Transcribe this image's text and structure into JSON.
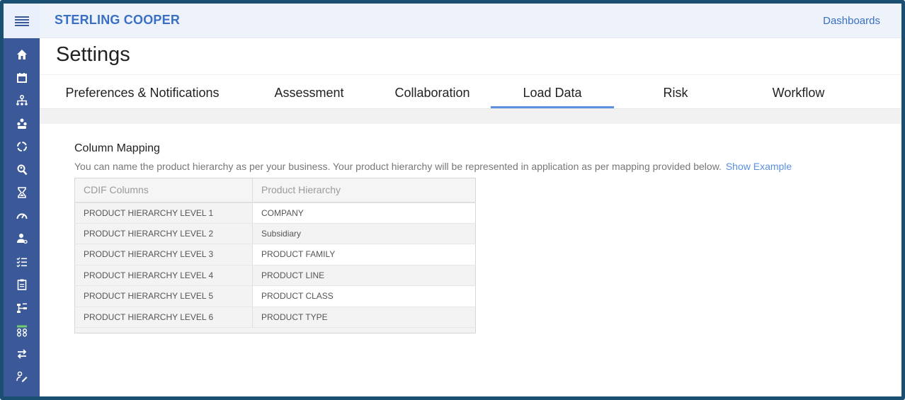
{
  "header": {
    "brand": "STERLING COOPER",
    "dashboards_link": "Dashboards"
  },
  "sidebar": {
    "icons": [
      "home-icon",
      "calendar-icon",
      "org-chart-icon",
      "people-group-icon",
      "cycle-icon",
      "search-person-icon",
      "hourglass-icon",
      "gauge-icon",
      "user-settings-icon",
      "checklist-icon",
      "clipboard-icon",
      "hierarchy-icon",
      "network-icon",
      "swap-icon",
      "user-edit-icon"
    ]
  },
  "page": {
    "title": "Settings"
  },
  "tabs": [
    {
      "label": "Preferences & Notifications"
    },
    {
      "label": "Assessment"
    },
    {
      "label": "Collaboration"
    },
    {
      "label": "Load Data"
    },
    {
      "label": "Risk"
    },
    {
      "label": "Workflow"
    }
  ],
  "active_tab": "Load Data",
  "column_mapping": {
    "title": "Column Mapping",
    "description": "You can name the product hierarchy as per your business. Your product hierarchy will be represented in application as per mapping provided below.",
    "show_example": "Show Example",
    "headers": [
      "CDIF Columns",
      "Product Hierarchy"
    ],
    "rows": [
      {
        "cdif": "PRODUCT HIERARCHY LEVEL 1",
        "hierarchy": "COMPANY"
      },
      {
        "cdif": "PRODUCT HIERARCHY LEVEL 2",
        "hierarchy": "Subsidiary"
      },
      {
        "cdif": "PRODUCT HIERARCHY LEVEL 3",
        "hierarchy": "PRODUCT FAMILY"
      },
      {
        "cdif": "PRODUCT HIERARCHY LEVEL 4",
        "hierarchy": "PRODUCT LINE"
      },
      {
        "cdif": "PRODUCT HIERARCHY LEVEL 5",
        "hierarchy": "PRODUCT CLASS"
      },
      {
        "cdif": "PRODUCT HIERARCHY LEVEL 6",
        "hierarchy": "PRODUCT TYPE"
      }
    ]
  },
  "colors": {
    "sidebar": "#3b5998",
    "accent": "#3a6fc4",
    "tab_underline": "#5b8fe0"
  }
}
